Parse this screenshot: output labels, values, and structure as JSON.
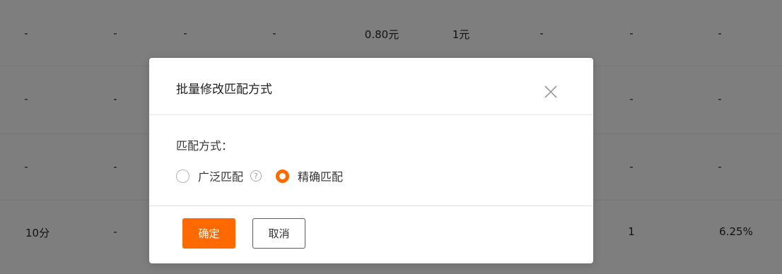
{
  "background_table": {
    "rows": [
      {
        "cells": [
          "-",
          "-",
          "-",
          "-",
          "0.80元",
          "1元",
          "-",
          "-",
          "-"
        ]
      },
      {
        "cells": [
          "-",
          "-",
          "-",
          "-"
        ]
      },
      {
        "cells": [
          "-",
          "-",
          "-",
          "-"
        ]
      },
      {
        "cells": [
          "10分",
          "-",
          "1",
          "6.25%"
        ]
      }
    ]
  },
  "dialog": {
    "title": "批量修改匹配方式",
    "close_icon": "close-icon",
    "field_label": "匹配方式：",
    "options": [
      {
        "label": "广泛匹配",
        "checked": false,
        "help": "?"
      },
      {
        "label": "精确匹配",
        "checked": true
      }
    ],
    "confirm_label": "确定",
    "cancel_label": "取消",
    "accent_color": "#ff6a00"
  }
}
